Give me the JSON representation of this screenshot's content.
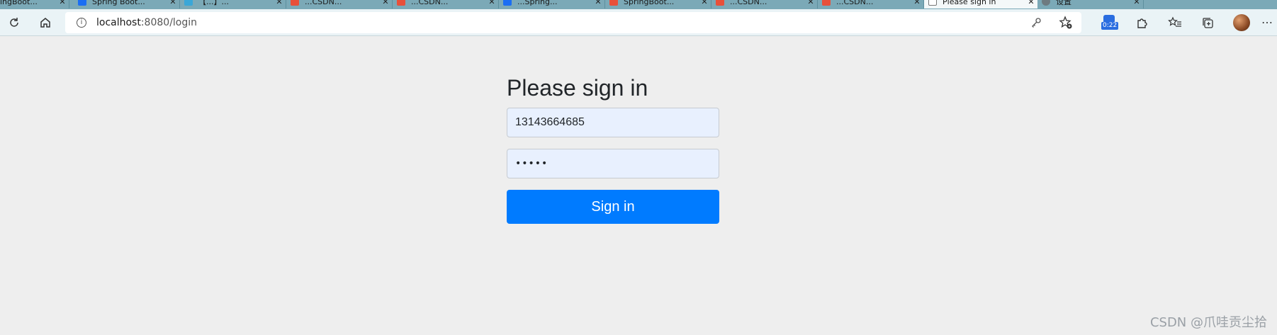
{
  "browser": {
    "tabs": [
      {
        "label": "ingBoot..."
      },
      {
        "label": "Spring Boot..."
      },
      {
        "label": "【...】..."
      },
      {
        "label": "...CSDN..."
      },
      {
        "label": "...CSDN..."
      },
      {
        "label": "...Spring..."
      },
      {
        "label": "SpringBoot..."
      },
      {
        "label": "...CSDN..."
      },
      {
        "label": "...CSDN..."
      },
      {
        "label": "Please sign in"
      },
      {
        "label": "设置"
      }
    ],
    "close_glyph": "✕",
    "url_host": "localhost",
    "url_path": ":8080/login",
    "extension_badge": "0:22"
  },
  "login": {
    "title": "Please sign in",
    "username_value": "13143664685",
    "password_mask": "•••••",
    "submit_label": "Sign in"
  },
  "watermark": "CSDN @爪哇贡尘拾",
  "colors": {
    "primary": "#007bff",
    "autofill_bg": "#e8f0fe",
    "page_bg": "#eeeeee",
    "tabstrip": "#7ba9b7"
  }
}
